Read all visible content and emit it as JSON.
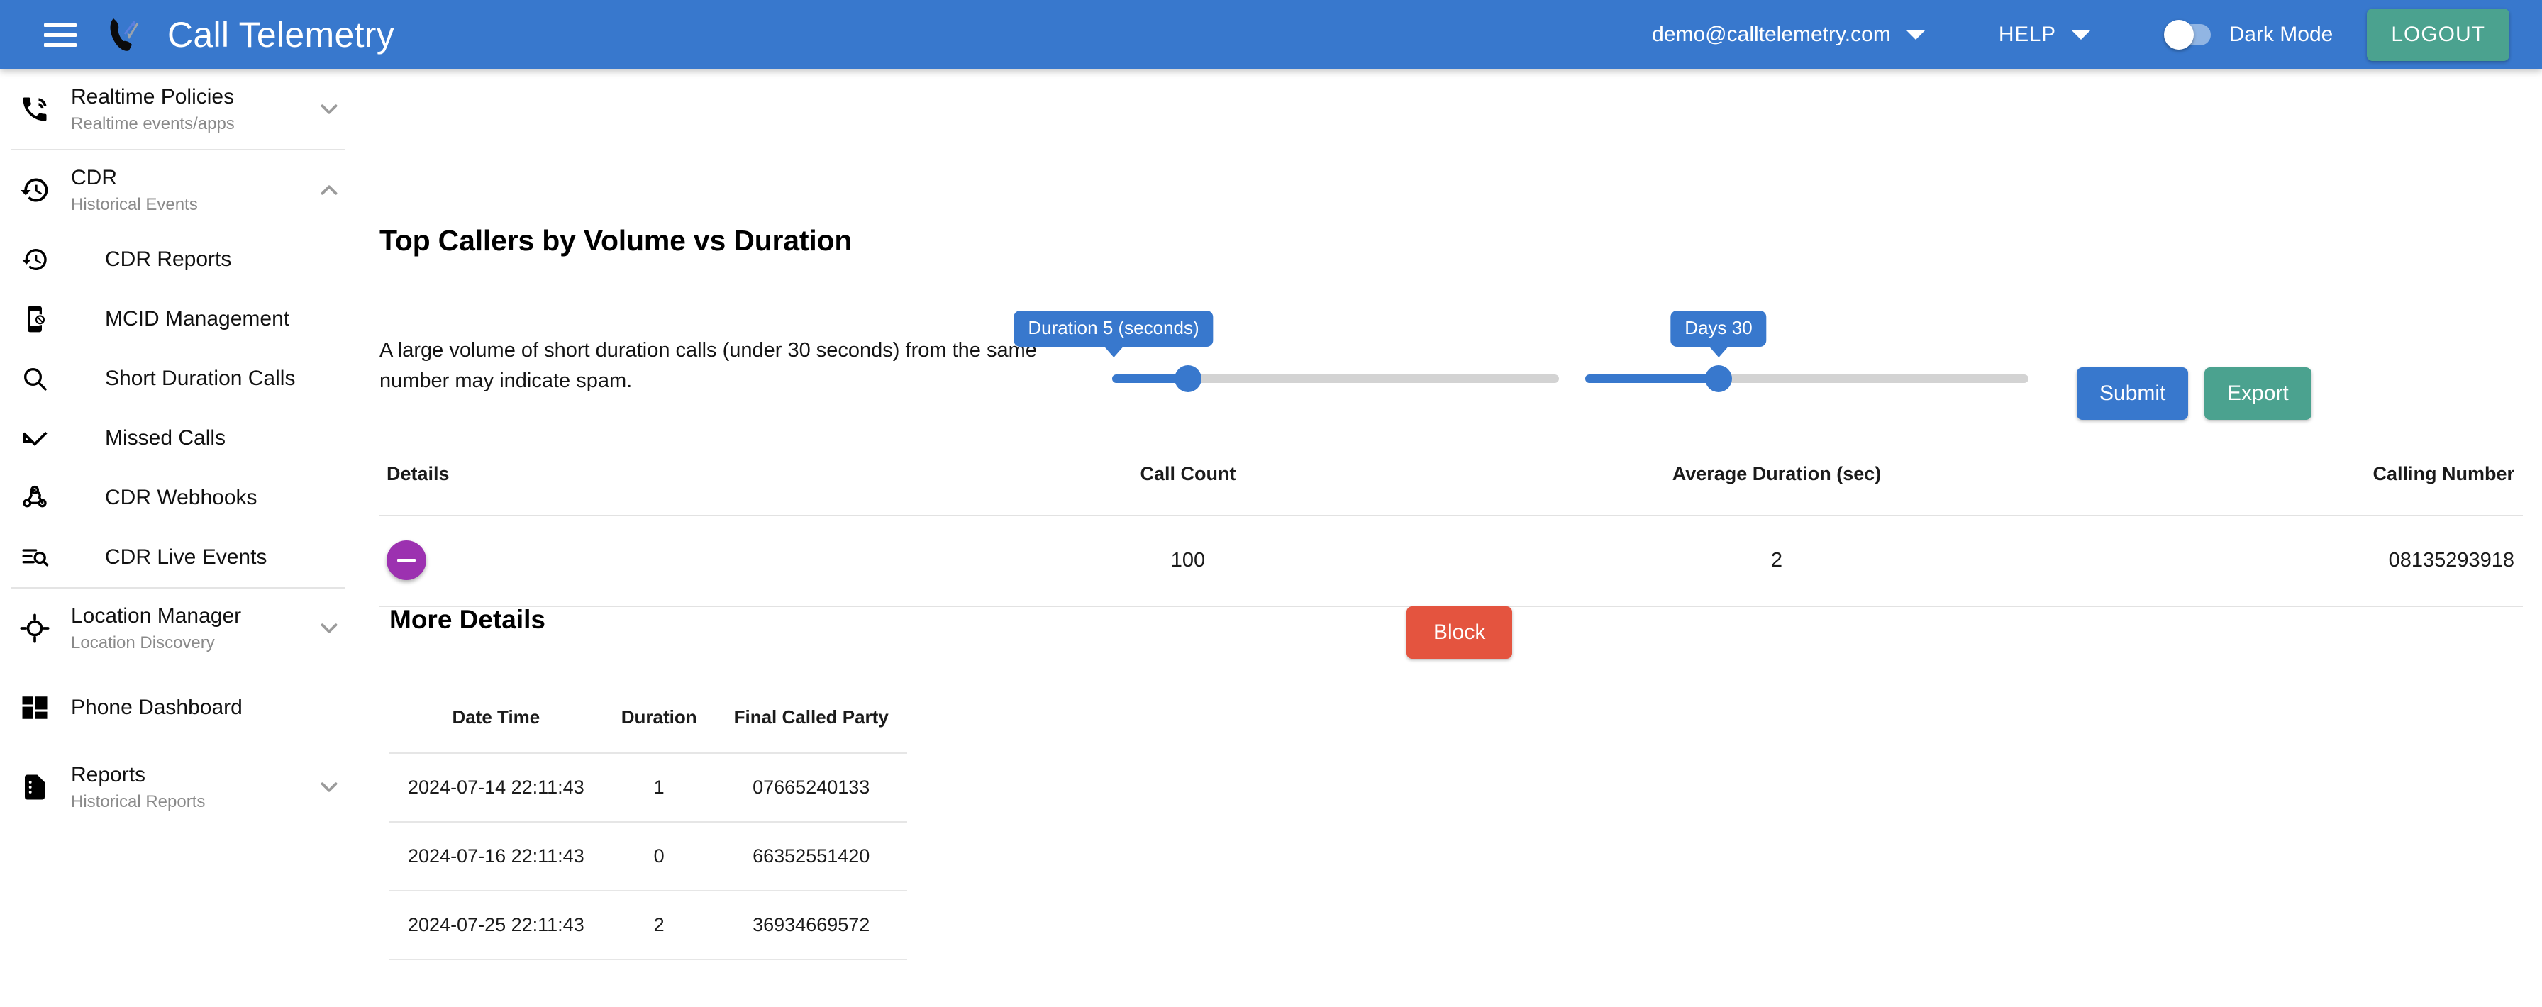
{
  "header": {
    "menu_icon": "hamburger-menu-icon",
    "logo_icon": "phone-telemetry-logo",
    "title": "Call Telemetry",
    "user_email": "demo@calltelemetry.com",
    "help_label": "HELP",
    "dark_mode_label": "Dark Mode",
    "dark_mode_on": false,
    "logout_label": "LOGOUT",
    "bar_color": "#3878cd",
    "logout_color": "#4ba28f"
  },
  "sidebar": {
    "groups": [
      {
        "icon": "phone-in-talk-icon",
        "title": "Realtime Policies",
        "subtitle": "Realtime events/apps",
        "chevron": "chevron-down-icon",
        "expanded": false,
        "items": []
      },
      {
        "icon": "history-icon",
        "title": "CDR",
        "subtitle": "Historical Events",
        "chevron": "chevron-up-icon",
        "expanded": true,
        "items": [
          {
            "icon": "history-icon",
            "label": "CDR Reports"
          },
          {
            "icon": "phone-blocked-icon",
            "label": "MCID Management"
          },
          {
            "icon": "search-icon",
            "label": "Short Duration Calls"
          },
          {
            "icon": "call-missed-icon",
            "label": "Missed Calls"
          },
          {
            "icon": "webhook-icon",
            "label": "CDR Webhooks"
          },
          {
            "icon": "search-list-icon",
            "label": "CDR Live Events"
          }
        ]
      },
      {
        "icon": "crosshair-location-icon",
        "title": "Location Manager",
        "subtitle": "Location Discovery",
        "chevron": "chevron-down-icon",
        "expanded": false,
        "items": []
      },
      {
        "icon": "dashboard-grid-icon",
        "title": "Phone Dashboard",
        "subtitle": "",
        "chevron": "",
        "expanded": false,
        "items": []
      },
      {
        "icon": "document-report-icon",
        "title": "Reports",
        "subtitle": "Historical Reports",
        "chevron": "chevron-down-icon",
        "expanded": false,
        "items": []
      }
    ]
  },
  "main": {
    "page_title": "Top Callers by Volume vs Duration",
    "blurb": "A large volume of short duration calls (under 30 seconds) from the same number may indicate spam.",
    "duration_slider": {
      "badge": "Duration 5 (seconds)",
      "value": 5,
      "percent": 17
    },
    "days_slider": {
      "badge": "Days 30",
      "value": 30,
      "percent": 30
    },
    "submit_label": "Submit",
    "export_label": "Export",
    "block_label": "Block",
    "submit_color": "#3878cd",
    "export_color": "#4ba28f",
    "block_color": "#e4543f",
    "table": {
      "headers": {
        "details": "Details",
        "call_count": "Call Count",
        "avg_duration": "Average Duration (sec)",
        "calling_number": "Calling Number"
      },
      "rows": [
        {
          "expand_icon": "collapse-minus-icon",
          "call_count": "100",
          "avg_duration": "2",
          "calling_number": "08135293918"
        }
      ]
    },
    "more_details": {
      "heading": "More Details",
      "headers": {
        "date_time": "Date Time",
        "duration": "Duration",
        "final_called_party": "Final Called Party"
      },
      "rows": [
        {
          "date_time": "2024-07-14 22:11:43",
          "duration": "1",
          "final_called_party": "07665240133"
        },
        {
          "date_time": "2024-07-16 22:11:43",
          "duration": "0",
          "final_called_party": "66352551420"
        },
        {
          "date_time": "2024-07-25 22:11:43",
          "duration": "2",
          "final_called_party": "36934669572"
        }
      ]
    }
  }
}
